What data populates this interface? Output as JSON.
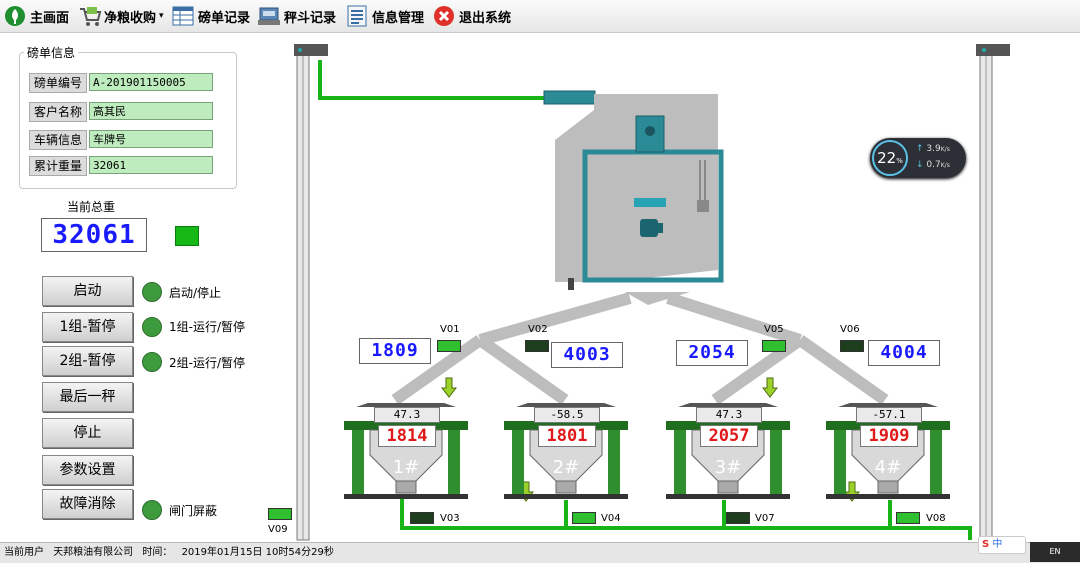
{
  "toolbar": {
    "home": "主画面",
    "purchase": "净粮收购",
    "weigh_records": "磅单记录",
    "hopper_records": "秤斗记录",
    "info_mgmt": "信息管理",
    "exit": "退出系统"
  },
  "ticket": {
    "legend": "磅单信息",
    "fields": [
      {
        "label": "磅单编号",
        "value": "A-201901150005"
      },
      {
        "label": "客户名称",
        "value": "高其民"
      },
      {
        "label": "车辆信息",
        "value": "车牌号"
      },
      {
        "label": "累计重量",
        "value": "32061"
      }
    ]
  },
  "total": {
    "label": "当前总重",
    "value": "32061"
  },
  "controls": {
    "start": "启动",
    "group1_pause": "1组-暂停",
    "group2_pause": "2组-暂停",
    "last_weigh": "最后一秤",
    "stop": "停止",
    "settings": "参数设置",
    "clear_fault": "故障消除"
  },
  "indicators": {
    "start_stop": "启动/停止",
    "group1": "1组-运行/暂停",
    "group2": "2组-运行/暂停",
    "gate_shield": "闸门屏蔽"
  },
  "valves": {
    "V01": "V01",
    "V02": "V02",
    "V03": "V03",
    "V04": "V04",
    "V05": "V05",
    "V06": "V06",
    "V07": "V07",
    "V08": "V08",
    "V09": "V09"
  },
  "upper_readings": {
    "r1": "1809",
    "r2": "4003",
    "r3": "2054",
    "r4": "4004"
  },
  "hoppers": [
    {
      "label": "1#",
      "top": "47.3",
      "red": "1814"
    },
    {
      "label": "2#",
      "top": "-58.5",
      "red": "1801"
    },
    {
      "label": "3#",
      "top": "47.3",
      "red": "2057"
    },
    {
      "label": "4#",
      "top": "-57.1",
      "red": "1909"
    }
  ],
  "network_widget": {
    "percent": "22",
    "up": "3.9",
    "down": "0.7",
    "unit": "K/s"
  },
  "status": {
    "user_label": "当前用户",
    "user": "天邦粮油有限公司",
    "time_label": "时间：",
    "time": "2019年01月15日 10时54分29秒"
  },
  "tray": {
    "ime": "中",
    "lang": "EN"
  },
  "colors": {
    "green_pipe": "#18b418",
    "teal": "#2a8a96",
    "gray": "#bdbdbd",
    "hopper_green": "#2f8f2f",
    "lcd_blue": "#1a1aff",
    "lcd_red": "#e01a1a"
  }
}
